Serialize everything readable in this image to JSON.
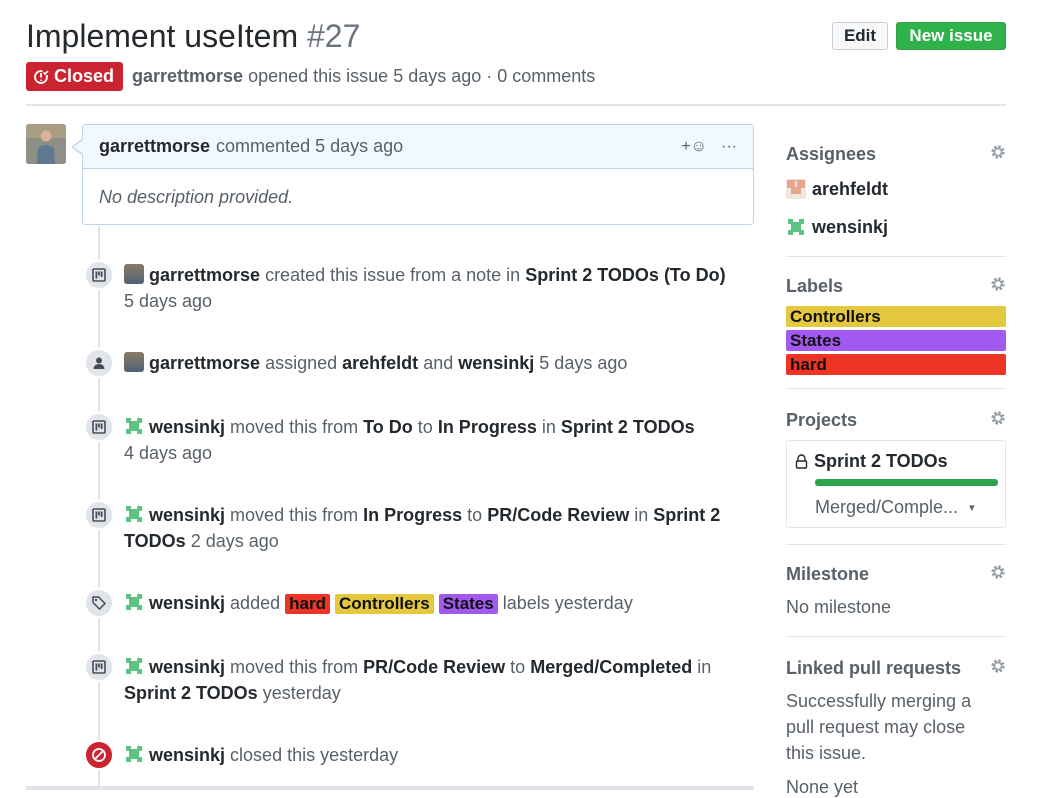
{
  "issue": {
    "title": "Implement useItem",
    "number": "#27",
    "state": "Closed",
    "author": "garrettmorse",
    "opened_text": "opened this issue",
    "opened_ago": "5 days ago",
    "comments_count": "· 0 comments"
  },
  "header": {
    "edit_label": "Edit",
    "new_issue_label": "New issue"
  },
  "comment": {
    "author": "garrettmorse",
    "action": "commented 5 days ago",
    "body": "No description provided.",
    "emoji_label": "+☺",
    "more_label": "···"
  },
  "timeline": [
    {
      "actor": "garrettmorse",
      "t1": "created this issue from a note in",
      "project": "Sprint 2 TODOs",
      "column": "(To Do)",
      "time": "5 days ago"
    },
    {
      "actor": "garrettmorse",
      "t1": "assigned",
      "user1": "arehfeldt",
      "t2": "and",
      "user2": "wensinkj",
      "time": "5 days ago"
    },
    {
      "actor": "wensinkj",
      "t1": "moved this from",
      "from": "To Do",
      "t2": "to",
      "to": "In Progress",
      "t3": "in",
      "project": "Sprint 2 TODOs",
      "time": "4 days ago"
    },
    {
      "actor": "wensinkj",
      "t1": "moved this from",
      "from": "In Progress",
      "t2": "to",
      "to": "PR/Code Review",
      "t3": "in",
      "project_a": "Sprint 2",
      "project_b": "TODOs",
      "time": "2 days ago"
    },
    {
      "actor": "wensinkj",
      "t1": "added",
      "labels": [
        "hard",
        "Controllers",
        "States"
      ],
      "t2": "labels",
      "time": "yesterday"
    },
    {
      "actor": "wensinkj",
      "t1": "moved this from",
      "from": "PR/Code Review",
      "t2": "to",
      "to": "Merged/Completed",
      "t3": "in",
      "project": "Sprint 2 TODOs",
      "time": "yesterday"
    },
    {
      "actor": "wensinkj",
      "t1": "closed this",
      "time": "yesterday"
    }
  ],
  "sidebar": {
    "assignees_title": "Assignees",
    "assignees": [
      "arehfeldt",
      "wensinkj"
    ],
    "labels_title": "Labels",
    "labels": [
      "Controllers",
      "States",
      "hard"
    ],
    "projects_title": "Projects",
    "project_name": "Sprint 2 TODOs",
    "project_column": "Merged/Comple...",
    "milestone_title": "Milestone",
    "milestone_value": "No milestone",
    "linked_title": "Linked pull requests",
    "linked_text_1": "Successfully merging a",
    "linked_text_2": "pull request may close",
    "linked_text_3": "this issue.",
    "linked_none": "None yet"
  },
  "colors": {
    "closed_red": "#cb2431",
    "new_issue_green": "#2fb24c",
    "label_controllers": "#e4c83d",
    "label_states": "#a259f0",
    "label_hard": "#ee3425",
    "progress_green": "#2ea44f"
  },
  "icons": [
    "closed-issue-icon",
    "project-icon",
    "person-icon",
    "tag-icon",
    "circle-slash-icon",
    "gear-icon",
    "lock-icon",
    "dropdown-caret-icon",
    "emoji-icon",
    "ellipsis-icon"
  ]
}
